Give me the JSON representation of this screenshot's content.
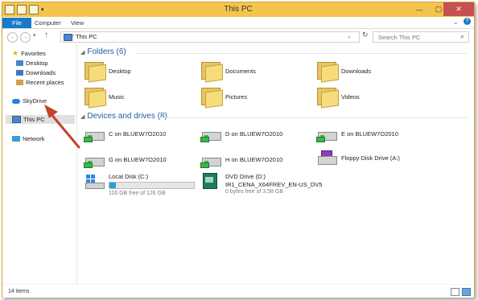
{
  "window": {
    "title": "This PC"
  },
  "ribbon": {
    "tabs": [
      "File",
      "Computer",
      "View"
    ]
  },
  "address": {
    "path": "This PC",
    "search_placeholder": "Search This PC"
  },
  "nav": {
    "favorites": "Favorites",
    "favorites_items": [
      "Desktop",
      "Downloads",
      "Recent places"
    ],
    "skydrive": "SkyDrive",
    "this_pc": "This PC",
    "network": "Network"
  },
  "folders": {
    "header": "Folders (6)",
    "items": [
      "Desktop",
      "Documents",
      "Downloads",
      "Music",
      "Pictures",
      "Videos"
    ]
  },
  "drives": {
    "header": "Devices and drives (8)",
    "items": [
      "C on BLUEW7O2010",
      "D on BLUEW7O2010",
      "E on BLUEW7O2010",
      "G on BLUEW7O2010",
      "H on BLUEW7O2010",
      "Floppy Disk Drive (A:)"
    ],
    "local_disk": {
      "label": "Local Disk (C:)",
      "free": "116 GB free of 126 GB",
      "used_fraction": 0.08
    },
    "dvd": {
      "label": "DVD Drive (D:)",
      "label2": "IR1_CENA_X64FREV_EN-US_DV5",
      "free": "0 bytes free of 3.58 GB"
    }
  },
  "status": {
    "items": "14 items"
  },
  "colors": {
    "title_bar": "#f4c44f",
    "accent": "#1979ca",
    "arrow": "#c0452c",
    "group_header": "#1f5b9e"
  }
}
